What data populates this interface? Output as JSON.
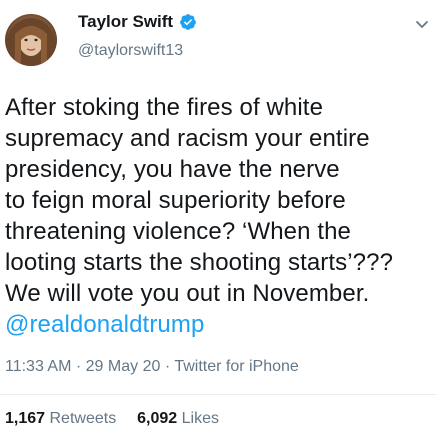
{
  "author": {
    "display_name": "Taylor Swift",
    "handle": "@taylorswift13",
    "verified": true,
    "avatar_icon": "profile-photo"
  },
  "tweet": {
    "lines": [
      "After stoking the fires of white",
      "supremacy and racism your entire",
      "presidency, you have the nerve",
      "to feign moral superiority before",
      "threatening violence? ‘When the",
      "looting starts the shooting starts’???",
      "We will vote you out in November."
    ],
    "mention": "@realdonaldtrump"
  },
  "meta": {
    "time": "11:33 AM",
    "date": "29 May 20",
    "source": "Twitter for iPhone",
    "separator": "·"
  },
  "stats": {
    "retweets_count": "1,167",
    "retweets_label": "Retweets",
    "likes_count": "6,092",
    "likes_label": "Likes"
  },
  "colors": {
    "link": "#1da1f2",
    "secondary_text": "#657786",
    "primary_text": "#14171a",
    "verified_badge": "#1da1f2"
  }
}
